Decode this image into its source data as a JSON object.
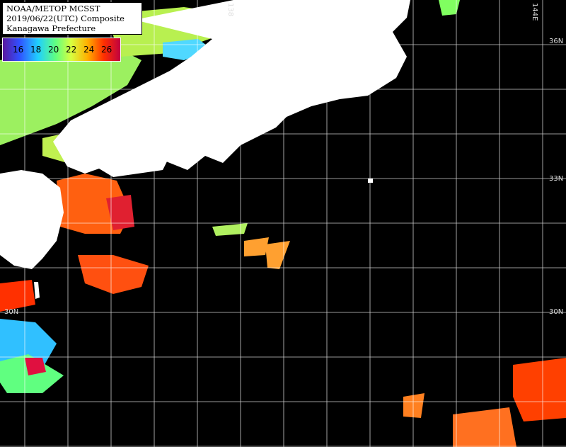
{
  "header": {
    "line1": "NOAA/METOP MCSST",
    "line2": "2019/06/22(UTC) Composite",
    "line3": "Kanagawa Prefecture"
  },
  "legend": {
    "ticks": [
      "16",
      "18",
      "20",
      "22",
      "24",
      "26"
    ],
    "colors": [
      "#5a18a0",
      "#3050ff",
      "#20d0ff",
      "#60ff80",
      "#d8ff40",
      "#ffb000",
      "#ff3000",
      "#c00040"
    ]
  },
  "axis": {
    "lat_36": "36N",
    "lat_33": "33N",
    "lat_30_left": "30N",
    "lat_30_right": "30N",
    "lon_138": "138",
    "lon_144": "144E"
  },
  "colors": {
    "land": "#ffffff",
    "ocean_no_data": "#000000",
    "grid": "#ffffff"
  }
}
